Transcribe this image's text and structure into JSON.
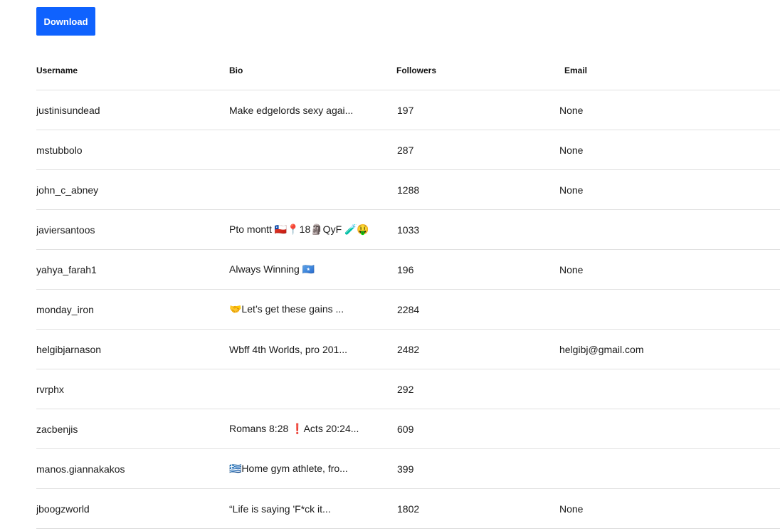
{
  "toolbar": {
    "download_label": "Download"
  },
  "table": {
    "columns": [
      "Username",
      "Bio",
      "Followers",
      "Email"
    ],
    "rows": [
      {
        "username": "justinisundead",
        "bio": "Make edgelords sexy agai...",
        "followers": "197",
        "email": "None"
      },
      {
        "username": "mstubbolo",
        "bio": "",
        "followers": "287",
        "email": "None"
      },
      {
        "username": "john_c_abney",
        "bio": "",
        "followers": "1288",
        "email": "None"
      },
      {
        "username": "javiersantoos",
        "bio": "Pto montt 🇨🇱📍18🗿QyF 🧪🤑",
        "followers": "1033",
        "email": ""
      },
      {
        "username": "yahya_farah1",
        "bio": "Always Winning 🇸🇴",
        "followers": "196",
        "email": "None"
      },
      {
        "username": "monday_iron",
        "bio": "🤝Let’s get these gains ...",
        "followers": "2284",
        "email": ""
      },
      {
        "username": "helgibjarnason",
        "bio": "Wbff 4th Worlds, pro 201...",
        "followers": "2482",
        "email": "helgibj@gmail.com"
      },
      {
        "username": "rvrphx",
        "bio": "",
        "followers": "292",
        "email": ""
      },
      {
        "username": "zacbenjis",
        "bio": "Romans 8:28 ❗Acts 20:24...",
        "followers": "609",
        "email": ""
      },
      {
        "username": "manos.giannakakos",
        "bio": "🇬🇷Home gym athlete, fro...",
        "followers": "399",
        "email": ""
      },
      {
        "username": "jboogzworld",
        "bio": "“Life is saying 'F*ck it...",
        "followers": "1802",
        "email": "None"
      }
    ]
  },
  "colors": {
    "accent": "#0f62fe",
    "divider": "#e0e0e0"
  }
}
